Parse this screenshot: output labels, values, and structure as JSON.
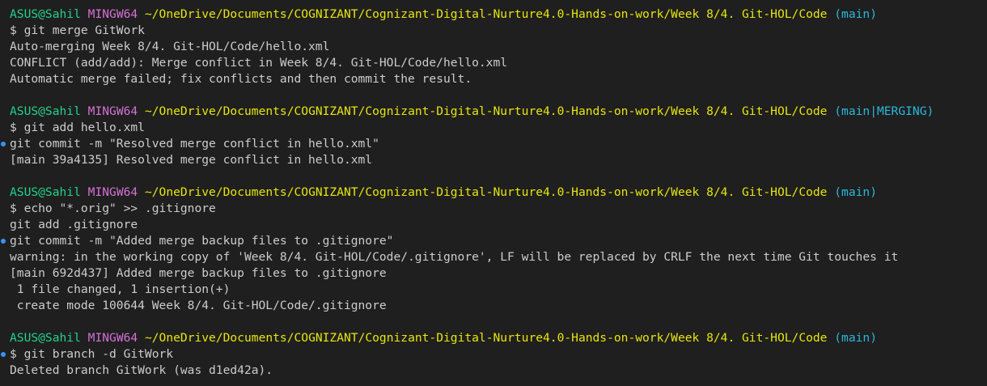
{
  "colors": {
    "background": "#1f1f1f",
    "text": "#cccccc",
    "user_host": "#23d18b",
    "msystem": "#d670d6",
    "path": "#e5e510",
    "branch": "#29b8db",
    "command_dot": "#3794ff"
  },
  "prompts": [
    {
      "user": "ASUS@Sahil",
      "msystem": "MINGW64",
      "path": "~/OneDrive/Documents/COGNIZANT/Cognizant-Digital-Nurture4.0-Hands-on-work/Week 8/4. Git-HOL/Code",
      "branch": "(main)"
    },
    {
      "user": "ASUS@Sahil",
      "msystem": "MINGW64",
      "path": "~/OneDrive/Documents/COGNIZANT/Cognizant-Digital-Nurture4.0-Hands-on-work/Week 8/4. Git-HOL/Code",
      "branch": "(main|MERGING)"
    },
    {
      "user": "ASUS@Sahil",
      "msystem": "MINGW64",
      "path": "~/OneDrive/Documents/COGNIZANT/Cognizant-Digital-Nurture4.0-Hands-on-work/Week 8/4. Git-HOL/Code",
      "branch": "(main)"
    },
    {
      "user": "ASUS@Sahil",
      "msystem": "MINGW64",
      "path": "~/OneDrive/Documents/COGNIZANT/Cognizant-Digital-Nurture4.0-Hands-on-work/Week 8/4. Git-HOL/Code",
      "branch": "(main)"
    }
  ],
  "blocks": [
    {
      "lines": [
        {
          "text": "$ git merge GitWork",
          "dot": false
        },
        {
          "text": "Auto-merging Week 8/4. Git-HOL/Code/hello.xml",
          "dot": false
        },
        {
          "text": "CONFLICT (add/add): Merge conflict in Week 8/4. Git-HOL/Code/hello.xml",
          "dot": false
        },
        {
          "text": "Automatic merge failed; fix conflicts and then commit the result.",
          "dot": false
        }
      ]
    },
    {
      "lines": [
        {
          "text": "$ git add hello.xml",
          "dot": false
        },
        {
          "text": "git commit -m \"Resolved merge conflict in hello.xml\"",
          "dot": true
        },
        {
          "text": "[main 39a4135] Resolved merge conflict in hello.xml",
          "dot": false
        }
      ]
    },
    {
      "lines": [
        {
          "text": "$ echo \"*.orig\" >> .gitignore",
          "dot": false
        },
        {
          "text": "git add .gitignore",
          "dot": false
        },
        {
          "text": "git commit -m \"Added merge backup files to .gitignore\"",
          "dot": true
        },
        {
          "text": "warning: in the working copy of 'Week 8/4. Git-HOL/Code/.gitignore', LF will be replaced by CRLF the next time Git touches it",
          "dot": false
        },
        {
          "text": "[main 692d437] Added merge backup files to .gitignore",
          "dot": false
        },
        {
          "text": " 1 file changed, 1 insertion(+)",
          "dot": false
        },
        {
          "text": " create mode 100644 Week 8/4. Git-HOL/Code/.gitignore",
          "dot": false
        }
      ]
    },
    {
      "lines": [
        {
          "text": "$ git branch -d GitWork",
          "dot": true
        },
        {
          "text": "Deleted branch GitWork (was d1ed42a).",
          "dot": false
        }
      ]
    }
  ]
}
